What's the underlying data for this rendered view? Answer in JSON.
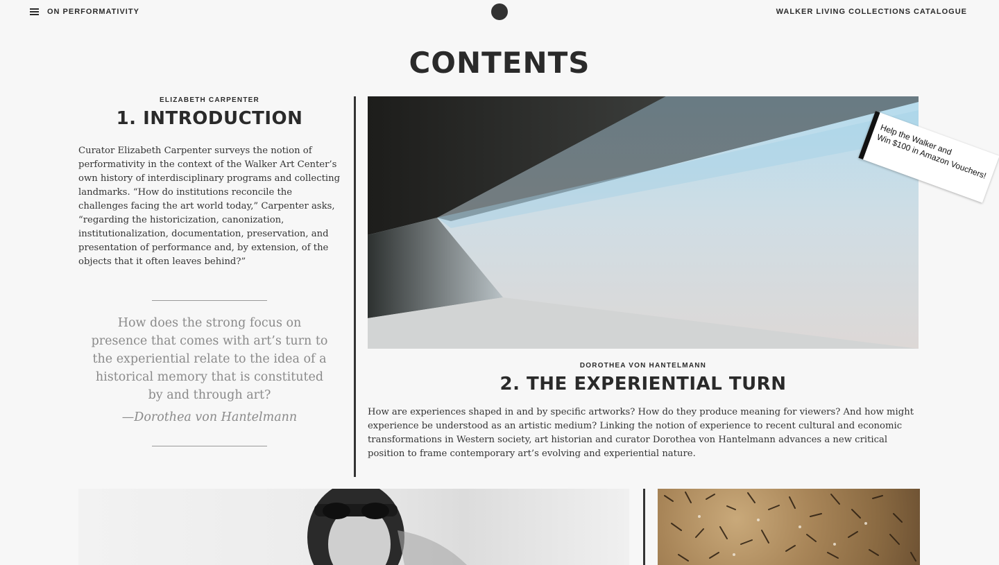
{
  "header": {
    "menu_label": "ON PERFORMATIVITY",
    "catalogue_link": "WALKER LIVING COLLECTIONS CATALOGUE"
  },
  "page_title": "CONTENTS",
  "essays": [
    {
      "author": "ELIZABETH CARPENTER",
      "title": "1. INTRODUCTION",
      "summary": "Curator Elizabeth Carpenter surveys the notion of performativity in the context of the Walker Art Center’s own history of interdisciplinary programs and collecting landmarks. “How do institutions reconcile the challenges facing the art world today,” Carpenter asks, “regarding the historicization, canonization, institutionalization, documentation, preservation, and presentation of performance and, by extension, of the objects that it often leaves behind?”"
    },
    {
      "author": "DOROTHEA VON HANTELMANN",
      "title": "2. THE EXPERIENTIAL TURN",
      "summary": "How are experiences shaped in and by specific artworks? How do they produce meaning for viewers? And how might experience be understood as an artistic medium? Linking the notion of experience to recent cultural and economic transformations in Western society, art historian and curator Dorothea von Hantelmann advances a new critical position to frame contemporary art’s evolving and experiential nature."
    }
  ],
  "pull_quote": {
    "text": "How does the strong focus on presence that comes with art’s turn to the experiential relate to the idea of a historical memory that is constituted by and through art?",
    "attribution": "—Dorothea von Hantelmann"
  },
  "promo": {
    "line1": "Help the Walker and",
    "line2": "Win $100 in Amazon Vouchers!"
  },
  "icons": {
    "menu": "hamburger-icon",
    "logo": "circle-logo"
  }
}
